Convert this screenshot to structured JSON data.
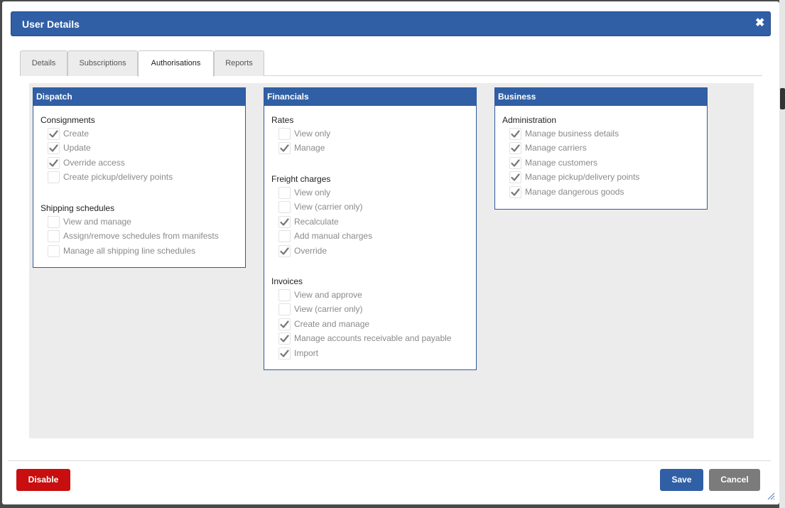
{
  "dialog": {
    "title": "User Details"
  },
  "tabs": [
    {
      "label": "Details"
    },
    {
      "label": "Subscriptions"
    },
    {
      "label": "Authorisations"
    },
    {
      "label": "Reports"
    }
  ],
  "active_tab": "Authorisations",
  "panels": [
    {
      "title": "Dispatch",
      "groups": [
        {
          "title": "Consignments",
          "options": [
            {
              "label": "Create",
              "checked": true
            },
            {
              "label": "Update",
              "checked": true
            },
            {
              "label": "Override access",
              "checked": true
            },
            {
              "label": "Create pickup/delivery points",
              "checked": false
            }
          ]
        },
        {
          "title": "Shipping schedules",
          "options": [
            {
              "label": "View and manage",
              "checked": false
            },
            {
              "label": "Assign/remove schedules from manifests",
              "checked": false
            },
            {
              "label": "Manage all shipping line schedules",
              "checked": false
            }
          ]
        }
      ]
    },
    {
      "title": "Financials",
      "groups": [
        {
          "title": "Rates",
          "options": [
            {
              "label": "View only",
              "checked": false
            },
            {
              "label": "Manage",
              "checked": true
            }
          ]
        },
        {
          "title": "Freight charges",
          "options": [
            {
              "label": "View only",
              "checked": false
            },
            {
              "label": "View (carrier only)",
              "checked": false
            },
            {
              "label": "Recalculate",
              "checked": true
            },
            {
              "label": "Add manual charges",
              "checked": false
            },
            {
              "label": "Override",
              "checked": true
            }
          ]
        },
        {
          "title": "Invoices",
          "options": [
            {
              "label": "View and approve",
              "checked": false
            },
            {
              "label": "View (carrier only)",
              "checked": false
            },
            {
              "label": "Create and manage",
              "checked": true
            },
            {
              "label": "Manage accounts receivable and payable",
              "checked": true
            },
            {
              "label": "Import",
              "checked": true
            }
          ]
        }
      ]
    },
    {
      "title": "Business",
      "groups": [
        {
          "title": "Administration",
          "options": [
            {
              "label": "Manage business details",
              "checked": true
            },
            {
              "label": "Manage carriers",
              "checked": true
            },
            {
              "label": "Manage customers",
              "checked": true
            },
            {
              "label": "Manage pickup/delivery points",
              "checked": true
            },
            {
              "label": "Manage dangerous goods",
              "checked": true
            }
          ]
        }
      ]
    }
  ],
  "footer": {
    "disable_label": "Disable",
    "save_label": "Save",
    "cancel_label": "Cancel"
  },
  "colors": {
    "primary": "#305fa5",
    "danger": "#c80e0e",
    "neutral": "#7b7b7b",
    "content_bg": "#ececec"
  }
}
